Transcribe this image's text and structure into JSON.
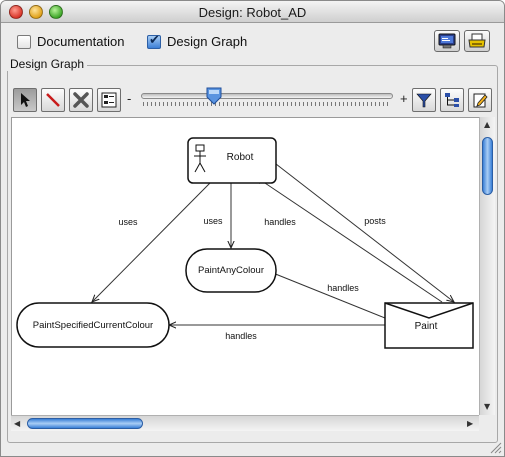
{
  "window": {
    "title": "Design: Robot_AD"
  },
  "options": {
    "documentation_label": "Documentation",
    "documentation_checked": false,
    "design_graph_label": "Design Graph",
    "design_graph_checked": true
  },
  "group": {
    "label": "Design Graph"
  },
  "toolbar": {
    "zoom_minus": "-",
    "zoom_plus": "+",
    "tools": [
      "select-tool",
      "line-tool",
      "delete-tool",
      "properties-tool"
    ],
    "right_tools": [
      "filter-tool",
      "layout-tool",
      "edit-tool"
    ]
  },
  "graph": {
    "nodes": {
      "robot": "Robot",
      "paint_any": "PaintAnyColour",
      "paint_specified": "PaintSpecifiedCurrentColour",
      "paint": "Paint"
    },
    "edges": {
      "uses_1": "uses",
      "uses_2": "uses",
      "handles_1": "handles",
      "posts": "posts",
      "handles_2": "handles",
      "handles_3": "handles"
    }
  },
  "colors": {
    "accent": "#3a7fd6",
    "window_bg": "#ececec"
  }
}
